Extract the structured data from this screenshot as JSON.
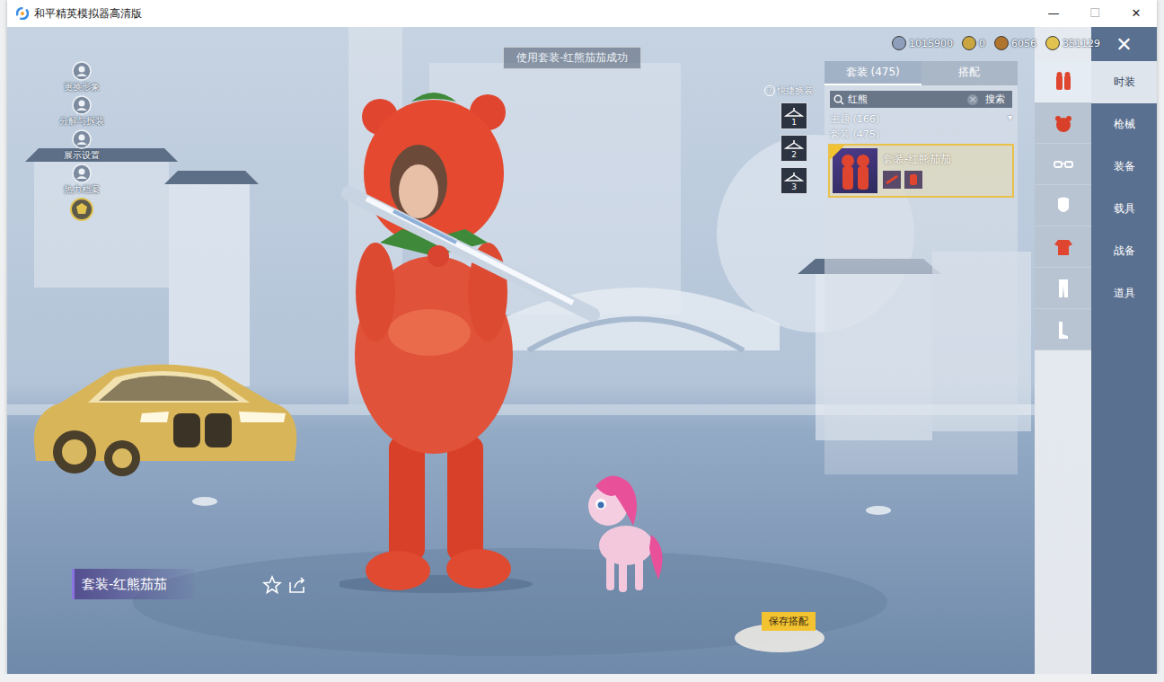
{
  "window": {
    "title": "和平精英模拟器高清版",
    "controls": [
      "—",
      "☐",
      "✕"
    ]
  },
  "toast": "使用套装-红熊茄茄成功",
  "side_menu": [
    {
      "label": "更换形象"
    },
    {
      "label": "分解与拆装"
    },
    {
      "label": "展示设置"
    },
    {
      "label": "热力档案"
    }
  ],
  "currencies": [
    {
      "value": "1015900",
      "color": "#8d9fbb"
    },
    {
      "value": "0",
      "color": "#c9a640"
    },
    {
      "value": "6056",
      "color": "#b0742e"
    },
    {
      "value": "351129",
      "color": "#e2c350"
    }
  ],
  "close": "✕",
  "catalog": {
    "tabs": [
      {
        "label": "套装 (475)",
        "selected": true
      },
      {
        "label": "搭配",
        "selected": false
      }
    ],
    "search": {
      "value": "红熊",
      "clear": "×",
      "button": "搜索"
    },
    "groups": [
      {
        "label": "主题 (166)",
        "expander": "▾"
      },
      {
        "label": "套装 (475)",
        "expander": ""
      }
    ],
    "items": [
      {
        "name": "套装-红熊茄茄",
        "selected": true
      }
    ]
  },
  "quick_change": {
    "label": "快捷换装",
    "help": "?",
    "slots": [
      "1",
      "2",
      "3"
    ]
  },
  "categories": [
    {
      "kind": "suit",
      "selected": true
    },
    {
      "kind": "hat",
      "selected": false
    },
    {
      "kind": "glasses",
      "selected": false
    },
    {
      "kind": "mask",
      "selected": false
    },
    {
      "kind": "top",
      "selected": false
    },
    {
      "kind": "pants",
      "selected": false
    },
    {
      "kind": "shoes",
      "selected": false
    }
  ],
  "nav": [
    {
      "label": "时装",
      "selected": true
    },
    {
      "label": "枪械",
      "selected": false
    },
    {
      "label": "装备",
      "selected": false
    },
    {
      "label": "载具",
      "selected": false
    },
    {
      "label": "战备",
      "selected": false
    },
    {
      "label": "道具",
      "selected": false
    }
  ],
  "outfit_name": "套装-红熊茄茄",
  "save_button": "保存搭配"
}
